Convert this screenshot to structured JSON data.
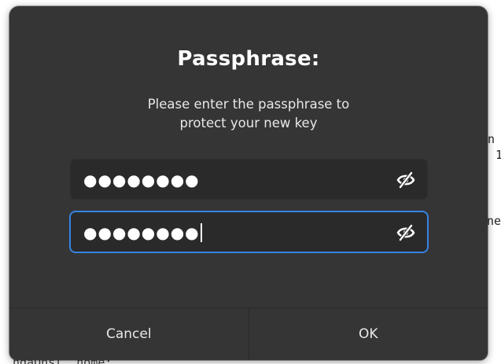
{
  "background": {
    "lines": [
      {
        "text": "n",
        "cls": "r1"
      },
      {
        "text": "1",
        "cls": "r2"
      },
      {
        "text": "ne",
        "cls": "r3"
      },
      {
        "text": "ndaQnsl, home:",
        "cls": "b1"
      }
    ]
  },
  "dialog": {
    "title": "Passphrase:",
    "message_line1": "Please enter the passphrase to",
    "message_line2": "protect your new key",
    "fields": [
      {
        "value": "●●●●●●●●",
        "focused": false,
        "visibility_icon": "eye-slash-icon"
      },
      {
        "value": "●●●●●●●●",
        "focused": true,
        "visibility_icon": "eye-slash-icon"
      }
    ],
    "buttons": {
      "cancel_label": "Cancel",
      "ok_label": "OK"
    }
  },
  "colors": {
    "dialog_bg": "#353535",
    "field_bg": "#2a2a2a",
    "focus_accent": "#3584e4",
    "text": "#ffffff"
  }
}
